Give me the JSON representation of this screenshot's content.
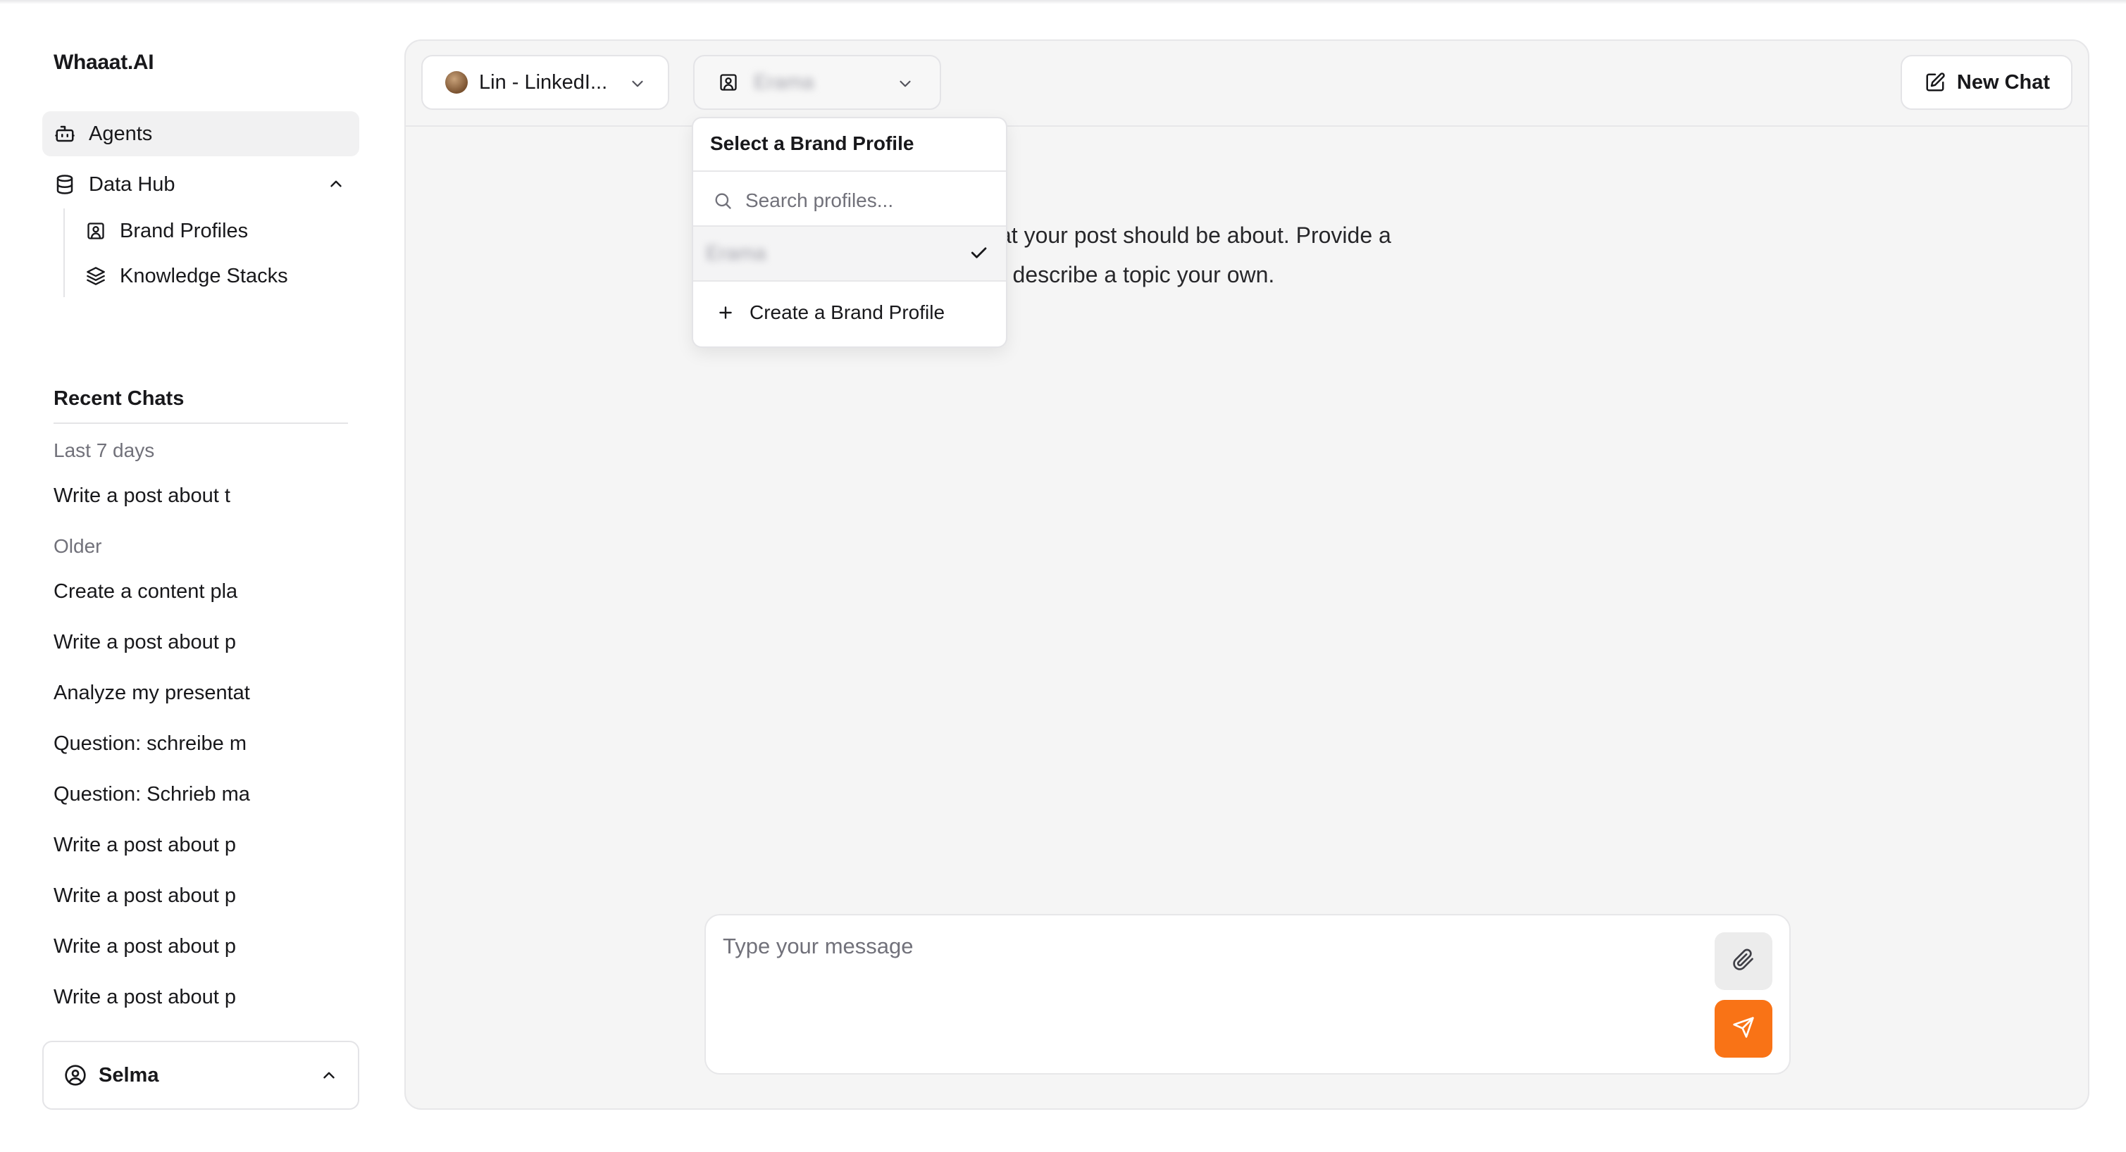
{
  "app": {
    "title": "Whaaat.AI"
  },
  "sidebar": {
    "nav": [
      {
        "label": "Agents",
        "icon": "bot-icon",
        "active": true
      },
      {
        "label": "Data Hub",
        "icon": "database-icon",
        "expanded": true
      }
    ],
    "data_hub_children": [
      {
        "label": "Brand Profiles",
        "icon": "user-square-icon"
      },
      {
        "label": "Knowledge Stacks",
        "icon": "layers-icon"
      }
    ],
    "recent": {
      "title": "Recent Chats",
      "groups": [
        {
          "label": "Last 7 days",
          "items": [
            "Write a post about t"
          ]
        },
        {
          "label": "Older",
          "items": [
            "Create a content pla",
            "Write a post about p",
            "Analyze my presentat",
            "Question: schreibe m",
            "Question: Schrieb ma",
            "Write a post about p",
            "Write a post about p",
            "Write a post about p",
            "Write a post about p"
          ]
        }
      ]
    },
    "user": {
      "name": "Selma",
      "icon": "user-circle-icon"
    }
  },
  "header": {
    "agent_selector": {
      "label": "Lin - LinkedI..."
    },
    "brand_selector": {
      "selected": "Erama"
    },
    "new_chat_label": "New Chat"
  },
  "intro": {
    "line1": "at your post should be about. Provide a",
    "line2": "r describe a topic your own."
  },
  "dropdown": {
    "title": "Select a Brand Profile",
    "search_placeholder": "Search profiles...",
    "options": [
      {
        "label": "Erama",
        "selected": true
      }
    ],
    "create_label": "Create a Brand Profile"
  },
  "composer": {
    "placeholder": "Type your message"
  },
  "colors": {
    "accent": "#f97316",
    "panel_bg": "#f5f5f5",
    "border": "#e4e4e7"
  }
}
